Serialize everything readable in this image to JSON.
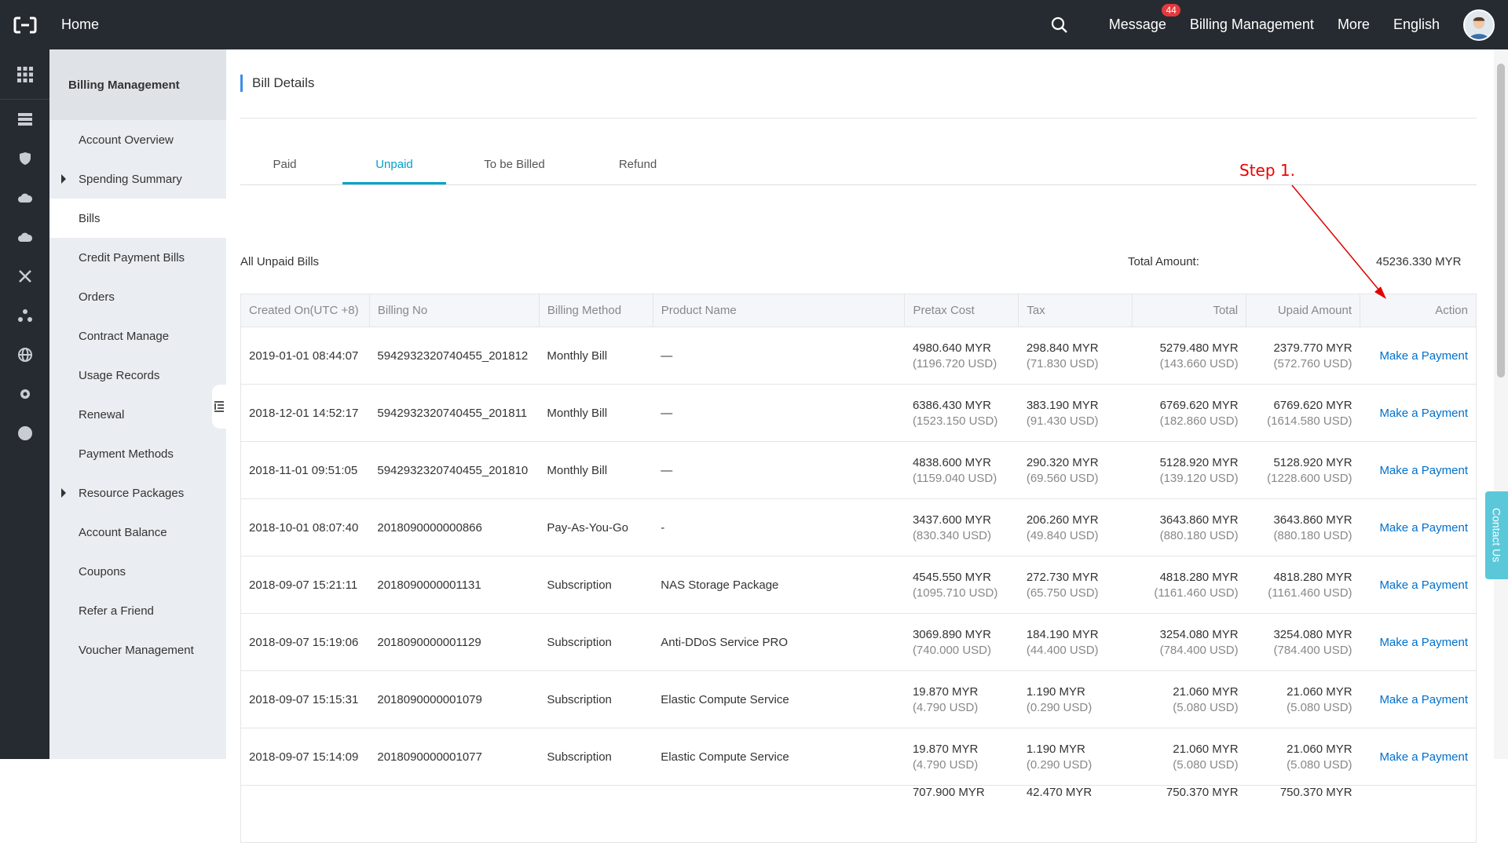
{
  "topbar": {
    "home": "Home",
    "message": "Message",
    "message_count": "44",
    "billing": "Billing Management",
    "more": "More",
    "language": "English"
  },
  "sidebar": {
    "title": "Billing Management",
    "items": [
      {
        "label": "Account Overview"
      },
      {
        "label": "Spending Summary"
      },
      {
        "label": "Bills"
      },
      {
        "label": "Credit Payment Bills"
      },
      {
        "label": "Orders"
      },
      {
        "label": "Contract Manage"
      },
      {
        "label": "Usage Records"
      },
      {
        "label": "Renewal"
      },
      {
        "label": "Payment Methods"
      },
      {
        "label": "Resource Packages"
      },
      {
        "label": "Account Balance"
      },
      {
        "label": "Coupons"
      },
      {
        "label": "Refer a Friend"
      },
      {
        "label": "Voucher Management"
      }
    ]
  },
  "main": {
    "title": "Bill Details",
    "tabs": [
      {
        "label": "Paid"
      },
      {
        "label": "Unpaid"
      },
      {
        "label": "To be Billed"
      },
      {
        "label": "Refund"
      }
    ],
    "summary_label": "All Unpaid Bills",
    "total_label": "Total Amount:",
    "total_value": "45236.330 MYR",
    "columns": [
      "Created On(UTC +8)",
      "Billing No",
      "Billing Method",
      "Product Name",
      "Pretax Cost",
      "Tax",
      "Total",
      "Upaid Amount",
      "Action"
    ],
    "rows": [
      {
        "created": "2019-01-01 08:44:07",
        "billing_no": "5942932320740455_201812",
        "method": "Monthly Bill",
        "product": "—",
        "pretax": "4980.640 MYR",
        "pretax_usd": "(1196.720 USD)",
        "tax": "298.840 MYR",
        "tax_usd": "(71.830 USD)",
        "total": "5279.480 MYR",
        "total_usd": "(143.660 USD)",
        "unpaid": "2379.770 MYR",
        "unpaid_usd": "(572.760 USD)",
        "action": "Make a Payment"
      },
      {
        "created": "2018-12-01 14:52:17",
        "billing_no": "5942932320740455_201811",
        "method": "Monthly Bill",
        "product": "—",
        "pretax": "6386.430 MYR",
        "pretax_usd": "(1523.150 USD)",
        "tax": "383.190 MYR",
        "tax_usd": "(91.430 USD)",
        "total": "6769.620 MYR",
        "total_usd": "(182.860 USD)",
        "unpaid": "6769.620 MYR",
        "unpaid_usd": "(1614.580 USD)",
        "action": "Make a Payment"
      },
      {
        "created": "2018-11-01 09:51:05",
        "billing_no": "5942932320740455_201810",
        "method": "Monthly Bill",
        "product": "—",
        "pretax": "4838.600 MYR",
        "pretax_usd": "(1159.040 USD)",
        "tax": "290.320 MYR",
        "tax_usd": "(69.560 USD)",
        "total": "5128.920 MYR",
        "total_usd": "(139.120 USD)",
        "unpaid": "5128.920 MYR",
        "unpaid_usd": "(1228.600 USD)",
        "action": "Make a Payment"
      },
      {
        "created": "2018-10-01 08:07:40",
        "billing_no": "2018090000000866",
        "method": "Pay-As-You-Go",
        "product": "-",
        "pretax": "3437.600 MYR",
        "pretax_usd": "(830.340 USD)",
        "tax": "206.260 MYR",
        "tax_usd": "(49.840 USD)",
        "total": "3643.860 MYR",
        "total_usd": "(880.180 USD)",
        "unpaid": "3643.860 MYR",
        "unpaid_usd": "(880.180 USD)",
        "action": "Make a Payment"
      },
      {
        "created": "2018-09-07 15:21:11",
        "billing_no": "2018090000001131",
        "method": "Subscription",
        "product": "NAS Storage Package",
        "pretax": "4545.550 MYR",
        "pretax_usd": "(1095.710 USD)",
        "tax": "272.730 MYR",
        "tax_usd": "(65.750 USD)",
        "total": "4818.280 MYR",
        "total_usd": "(1161.460 USD)",
        "unpaid": "4818.280 MYR",
        "unpaid_usd": "(1161.460 USD)",
        "action": "Make a Payment"
      },
      {
        "created": "2018-09-07 15:19:06",
        "billing_no": "2018090000001129",
        "method": "Subscription",
        "product": "Anti-DDoS Service PRO",
        "pretax": "3069.890 MYR",
        "pretax_usd": "(740.000 USD)",
        "tax": "184.190 MYR",
        "tax_usd": "(44.400 USD)",
        "total": "3254.080 MYR",
        "total_usd": "(784.400 USD)",
        "unpaid": "3254.080 MYR",
        "unpaid_usd": "(784.400 USD)",
        "action": "Make a Payment"
      },
      {
        "created": "2018-09-07 15:15:31",
        "billing_no": "2018090000001079",
        "method": "Subscription",
        "product": "Elastic Compute Service",
        "pretax": "19.870 MYR",
        "pretax_usd": "(4.790 USD)",
        "tax": "1.190 MYR",
        "tax_usd": "(0.290 USD)",
        "total": "21.060 MYR",
        "total_usd": "(5.080 USD)",
        "unpaid": "21.060 MYR",
        "unpaid_usd": "(5.080 USD)",
        "action": "Make a Payment"
      },
      {
        "created": "2018-09-07 15:14:09",
        "billing_no": "2018090000001077",
        "method": "Subscription",
        "product": "Elastic Compute Service",
        "pretax": "19.870 MYR",
        "pretax_usd": "(4.790 USD)",
        "tax": "1.190 MYR",
        "tax_usd": "(0.290 USD)",
        "total": "21.060 MYR",
        "total_usd": "(5.080 USD)",
        "unpaid": "21.060 MYR",
        "unpaid_usd": "(5.080 USD)",
        "action": "Make a Payment"
      },
      {
        "created": "",
        "billing_no": "",
        "method": "",
        "product": "",
        "pretax": "707.900 MYR",
        "pretax_usd": "",
        "tax": "42.470 MYR",
        "tax_usd": "",
        "total": "750.370 MYR",
        "total_usd": "",
        "unpaid": "750.370 MYR",
        "unpaid_usd": "",
        "action": ""
      }
    ]
  },
  "annotation": {
    "text": "Step 1.",
    "color": "#e00000"
  },
  "contact": "Contact Us",
  "colors": {
    "topbar": "#262b31",
    "accent": "#00a2ca",
    "link": "#0070cc"
  }
}
